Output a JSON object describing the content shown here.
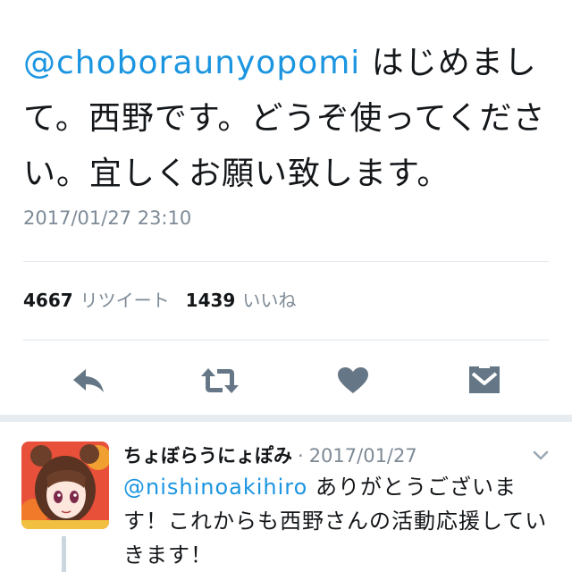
{
  "tweet": {
    "mention": "@choboraunyopomi",
    "text": " はじめまして。西野です。どうぞ使ってください。宜しくお願い致します。",
    "timestamp": "2017/01/27 23:10"
  },
  "stats": {
    "retweet_count": "4667",
    "retweet_label": "リツイート",
    "like_count": "1439",
    "like_label": "いいね"
  },
  "actions": {
    "reply_icon": "reply-icon",
    "retweet_icon": "retweet-icon",
    "like_icon": "heart-icon",
    "dm_icon": "envelope-icon"
  },
  "reply": {
    "name": "ちょぼらうにょぽみ",
    "separator": "·",
    "date": "2017/01/27",
    "mention": "@nishinoakihiro",
    "text": " ありがとうございます！これからも西野さんの活動応援していきます！"
  },
  "colors": {
    "link": "#1b95e0",
    "icon": "#657786",
    "muted": "#7d8a96"
  }
}
